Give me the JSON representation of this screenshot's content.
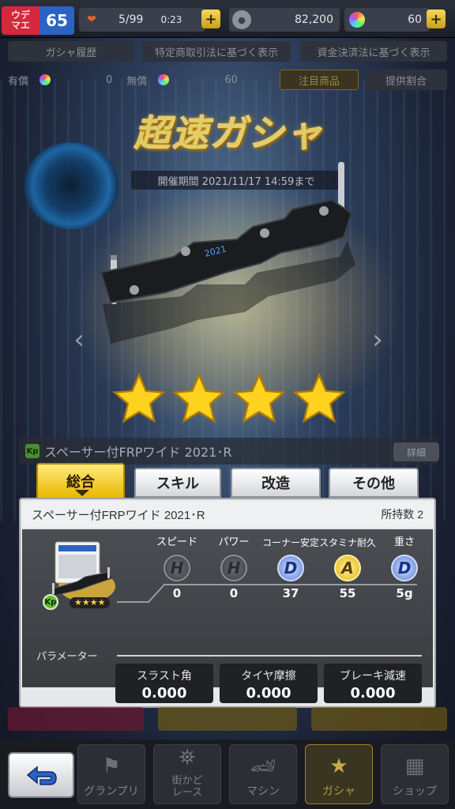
{
  "status": {
    "rank_label": "ウデ\nマエ",
    "rank_level": "65",
    "stamina": "5/99",
    "timer": "0:23",
    "money": "82,200",
    "gems": "60"
  },
  "header_buttons": {
    "gacha_history": "ガシャ履歴",
    "commerce_law": "特定商取引法に基づく表示",
    "payment_law": "資金決済法に基づく表示"
  },
  "currency_row": {
    "paid_label": "有償",
    "paid_value": "0",
    "free_label": "無償",
    "free_value": "60",
    "featured_tab": "注目商品",
    "rates_tab": "提供割合"
  },
  "banner": {
    "title": "超速ガシャ",
    "period": "開催期間 2021/11/17 14:59まで"
  },
  "underlying_item": {
    "badge": "Kp",
    "name": "スペーサー付FRPワイド 2021･R",
    "detail": "詳細"
  },
  "tabs": [
    {
      "label": "総合"
    },
    {
      "label": "スキル"
    },
    {
      "label": "改造"
    },
    {
      "label": "その他"
    }
  ],
  "panel": {
    "name": "スペーサー付FRPワイド 2021･R",
    "owned": "所持数 2",
    "kp_badge": "Kp",
    "card_stars": "★★★★",
    "stats": [
      {
        "name": "スピード",
        "grade": "H",
        "value": "0"
      },
      {
        "name": "パワー",
        "grade": "H",
        "value": "0"
      },
      {
        "name": "コーナー安定",
        "grade": "D",
        "value": "37"
      },
      {
        "name": "スタミナ耐久",
        "grade": "A",
        "value": "55"
      },
      {
        "name": "重さ",
        "grade": "D",
        "value": "5g"
      }
    ],
    "parameter_label": "パラメーター",
    "params": [
      {
        "name": "スラスト角",
        "value": "0.000"
      },
      {
        "name": "タイヤ摩擦",
        "value": "0.000"
      },
      {
        "name": "ブレーキ減速",
        "value": "0.000"
      }
    ]
  },
  "nav": {
    "grand_prix": "グランプリ",
    "street_race": "街かど\nレース",
    "machine": "マシン",
    "gacha": "ガシャ",
    "shop": "ショップ"
  },
  "rarity_stars": 4,
  "colors": {
    "accent_gold": "#e9b800",
    "grade_d": "#5a7ed6",
    "grade_a": "#e2b50c",
    "grade_h": "#3d4044"
  }
}
